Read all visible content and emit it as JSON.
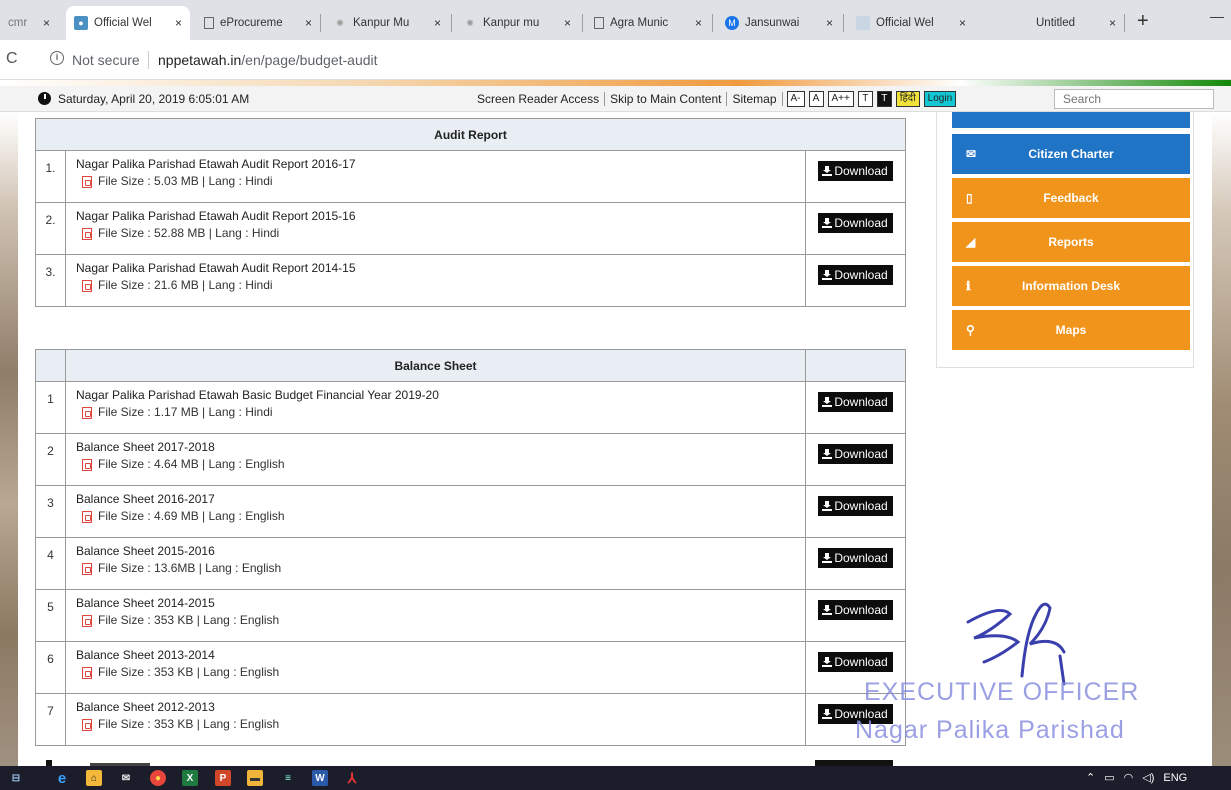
{
  "browser": {
    "tabs": [
      {
        "title": "cmr",
        "favicon": "doc-icon",
        "active": false
      },
      {
        "title": "Official Wel",
        "favicon": "site-icon",
        "active": true
      },
      {
        "title": "eProcureme",
        "favicon": "doc-icon",
        "active": false
      },
      {
        "title": "Kanpur Mu",
        "favicon": "emblem-icon",
        "active": false
      },
      {
        "title": "Kanpur mu",
        "favicon": "emblem-icon",
        "active": false
      },
      {
        "title": "Agra Munic",
        "favicon": "doc-icon",
        "active": false
      },
      {
        "title": "Jansunwai",
        "favicon": "m-icon",
        "active": false
      },
      {
        "title": "Official Wel",
        "favicon": "site-icon",
        "active": false
      },
      {
        "title": "Untitled",
        "favicon": "",
        "active": false
      }
    ],
    "close_glyph": "×",
    "new_tab_glyph": "+",
    "minimize_glyph": "—",
    "address": {
      "security_label": "Not secure",
      "host": "nppetawah.in",
      "path": "/en/page/budget-audit"
    }
  },
  "topstrip": {
    "datetime": "Saturday, April 20, 2019 6:05:01 AM",
    "links": [
      "Screen Reader Access",
      "Skip to Main Content",
      "Sitemap"
    ],
    "font_buttons": [
      "A-",
      "A",
      "A++",
      "T",
      "T"
    ],
    "hindi_label": "हिंदी",
    "login_label": "Login",
    "search_placeholder": "Search"
  },
  "audit_report": {
    "heading": "Audit Report",
    "rows": [
      {
        "num": "1.",
        "title": "Nagar Palika Parishad Etawah Audit Report 2016-17",
        "meta": "File Size : 5.03 MB | Lang : Hindi"
      },
      {
        "num": "2.",
        "title": "Nagar Palika Parishad Etawah Audit Report 2015-16",
        "meta": "File Size : 52.88 MB | Lang : Hindi"
      },
      {
        "num": "3.",
        "title": "Nagar Palika Parishad Etawah Audit Report 2014-15",
        "meta": "File Size : 21.6 MB | Lang : Hindi"
      }
    ]
  },
  "balance_sheet": {
    "heading": "Balance Sheet",
    "rows": [
      {
        "num": "1",
        "title": "Nagar Palika Parishad Etawah Basic Budget Financial Year 2019-20",
        "meta": "File Size : 1.17 MB | Lang : Hindi"
      },
      {
        "num": "2",
        "title": "Balance Sheet 2017-2018",
        "meta": "File Size : 4.64 MB | Lang : English"
      },
      {
        "num": "3",
        "title": "Balance Sheet 2016-2017",
        "meta": "File Size : 4.69 MB | Lang : English"
      },
      {
        "num": "4",
        "title": "Balance Sheet 2015-2016",
        "meta": "File Size : 13.6MB | Lang : English"
      },
      {
        "num": "5",
        "title": "Balance Sheet 2014-2015",
        "meta": "File Size : 353 KB | Lang : English"
      },
      {
        "num": "6",
        "title": "Balance Sheet 2013-2014",
        "meta": "File Size : 353 KB | Lang : English"
      },
      {
        "num": "7",
        "title": "Balance Sheet 2012-2013",
        "meta": "File Size : 353 KB | Lang : English"
      }
    ]
  },
  "download_label": "Download",
  "sidebar": {
    "items": [
      {
        "label": "Citizen Charter",
        "icon": "envelope-icon",
        "glyph": "✉",
        "color": "blue"
      },
      {
        "label": "Feedback",
        "icon": "file-icon",
        "glyph": "▯",
        "color": "orange"
      },
      {
        "label": "Reports",
        "icon": "bar-chart-icon",
        "glyph": "◢",
        "color": "orange"
      },
      {
        "label": "Information Desk",
        "icon": "info-icon",
        "glyph": "ℹ",
        "color": "orange"
      },
      {
        "label": "Maps",
        "icon": "map-pin-icon",
        "glyph": "⚲",
        "color": "orange"
      }
    ]
  },
  "stamp": {
    "line1": "EXECUTIVE OFFICER",
    "line2": "Nagar Palika Parishad"
  },
  "taskbar": {
    "tray_language": "ENG"
  },
  "colors": {
    "sidebar_blue": "#1f74c5",
    "sidebar_orange": "#f1941b",
    "hindi_button": "#f0e23a",
    "login_button": "#13c6d4",
    "stamp_ink": "#8a8fe0"
  }
}
